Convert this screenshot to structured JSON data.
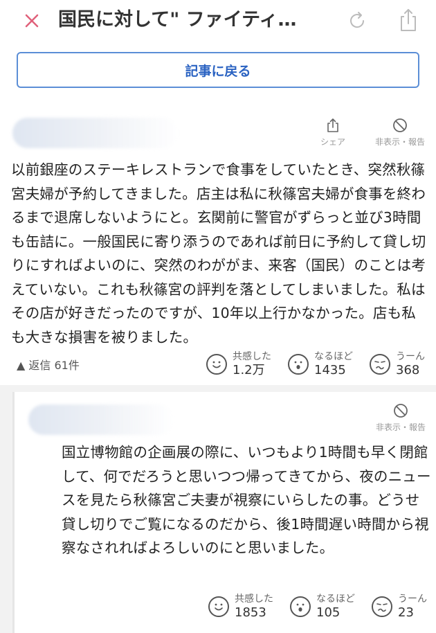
{
  "header": {
    "title": "国民に対して\" ファイティ…",
    "close_icon": "close-icon",
    "reload_icon": "reload-icon",
    "share_icon": "share-icon"
  },
  "back_button": {
    "label": "記事に戻る"
  },
  "comments": [
    {
      "share_label": "シェア",
      "hide_report_label": "非表示・報告",
      "text": "以前銀座のステーキレストランで食事をしていたとき、突然秋篠宮夫婦が予約してきました。店主は私に秋篠宮夫婦が食事を終わるまで退席しないようにと。玄関前に警官がずらっと並び3時間も缶詰に。一般国民に寄り添うのであれば前日に予約して貸し切りにすればよいのに、突然のわががま、来客（国民）のことは考えていない。これも秋篠宮の評判を落としてしまいました。私はその店が好きだったのですが、10年以上行かなかった。店も私も大きな損害を被りました。",
      "replies_label": "▲ 返信 61件",
      "reactions": [
        {
          "label": "共感した",
          "count": "1.2万"
        },
        {
          "label": "なるほど",
          "count": "1435"
        },
        {
          "label": "うーん",
          "count": "368"
        }
      ]
    },
    {
      "hide_report_label": "非表示・報告",
      "text": "国立博物館の企画展の際に、いつもより1時間も早く閉館して、何でだろうと思いつつ帰ってきてから、夜のニュースを見たら秋篠宮ご夫妻が視察にいらしたの事。どうせ貸し切りでご覧になるのだから、後1時間遅い時間から視察なされればよろしいのにと思いました。",
      "reactions": [
        {
          "label": "共感した",
          "count": "1853"
        },
        {
          "label": "なるほど",
          "count": "105"
        },
        {
          "label": "うーん",
          "count": "23"
        }
      ]
    }
  ]
}
